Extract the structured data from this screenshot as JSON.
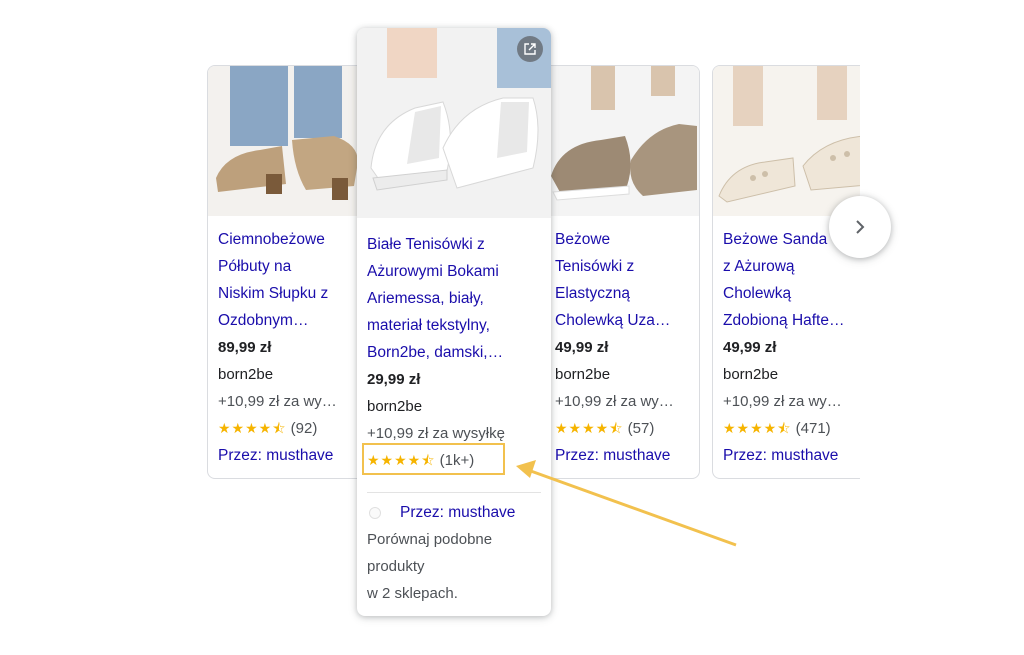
{
  "products": [
    {
      "title_lines": [
        "Ciemnobeżowe",
        "Półbuty na",
        "Niskim Słupku z",
        "Ozdobnym…"
      ],
      "price": "89,99 zł",
      "seller": "born2be",
      "shipping": "+10,99 zł za wy…",
      "stars": "★★★★⯪",
      "reviews": "(92)",
      "via": "Przez: musthave",
      "image_icon": "beige-ankle-shoe-photo"
    },
    {
      "title_lines": [
        "Beżowe",
        "Tenisówki z",
        "Elastyczną",
        "Cholewką Uza…"
      ],
      "price": "49,99 zł",
      "seller": "born2be",
      "shipping": "+10,99 zł za wy…",
      "stars": "★★★★⯪",
      "reviews": "(57)",
      "via": "Przez: musthave",
      "image_icon": "beige-knit-flat-photo"
    },
    {
      "title_lines": [
        "Beżowe Sanda",
        "z Ażurową",
        "Cholewką",
        "Zdobioną Hafte…"
      ],
      "price": "49,99 zł",
      "seller": "born2be",
      "shipping": "+10,99 zł za wy…",
      "stars": "★★★★⯪",
      "reviews": "(471)",
      "via": "Przez: musthave",
      "image_icon": "cream-sandal-photo"
    }
  ],
  "featured": {
    "title_lines": [
      "Białe Tenisówki z",
      "Ażurowymi Bokami",
      "Ariemessa, biały,",
      "materiał tekstylny,",
      "Born2be, damski,…"
    ],
    "price": "29,99 zł",
    "seller": "born2be",
    "shipping": "+10,99 zł za wysyłkę",
    "stars": "★★★★⯪",
    "reviews": "(1k+)",
    "via": "Przez: musthave",
    "compare_lines": [
      "Porównaj podobne",
      "produkty",
      "w 2 sklepach."
    ],
    "image_icon": "white-lace-sneaker-photo",
    "open_icon": "open-in-new-icon"
  },
  "next_icon": "chevron-right-icon",
  "colors": {
    "link": "#1a0dab",
    "star": "#f6b400",
    "annotation": "#f2c14e"
  }
}
